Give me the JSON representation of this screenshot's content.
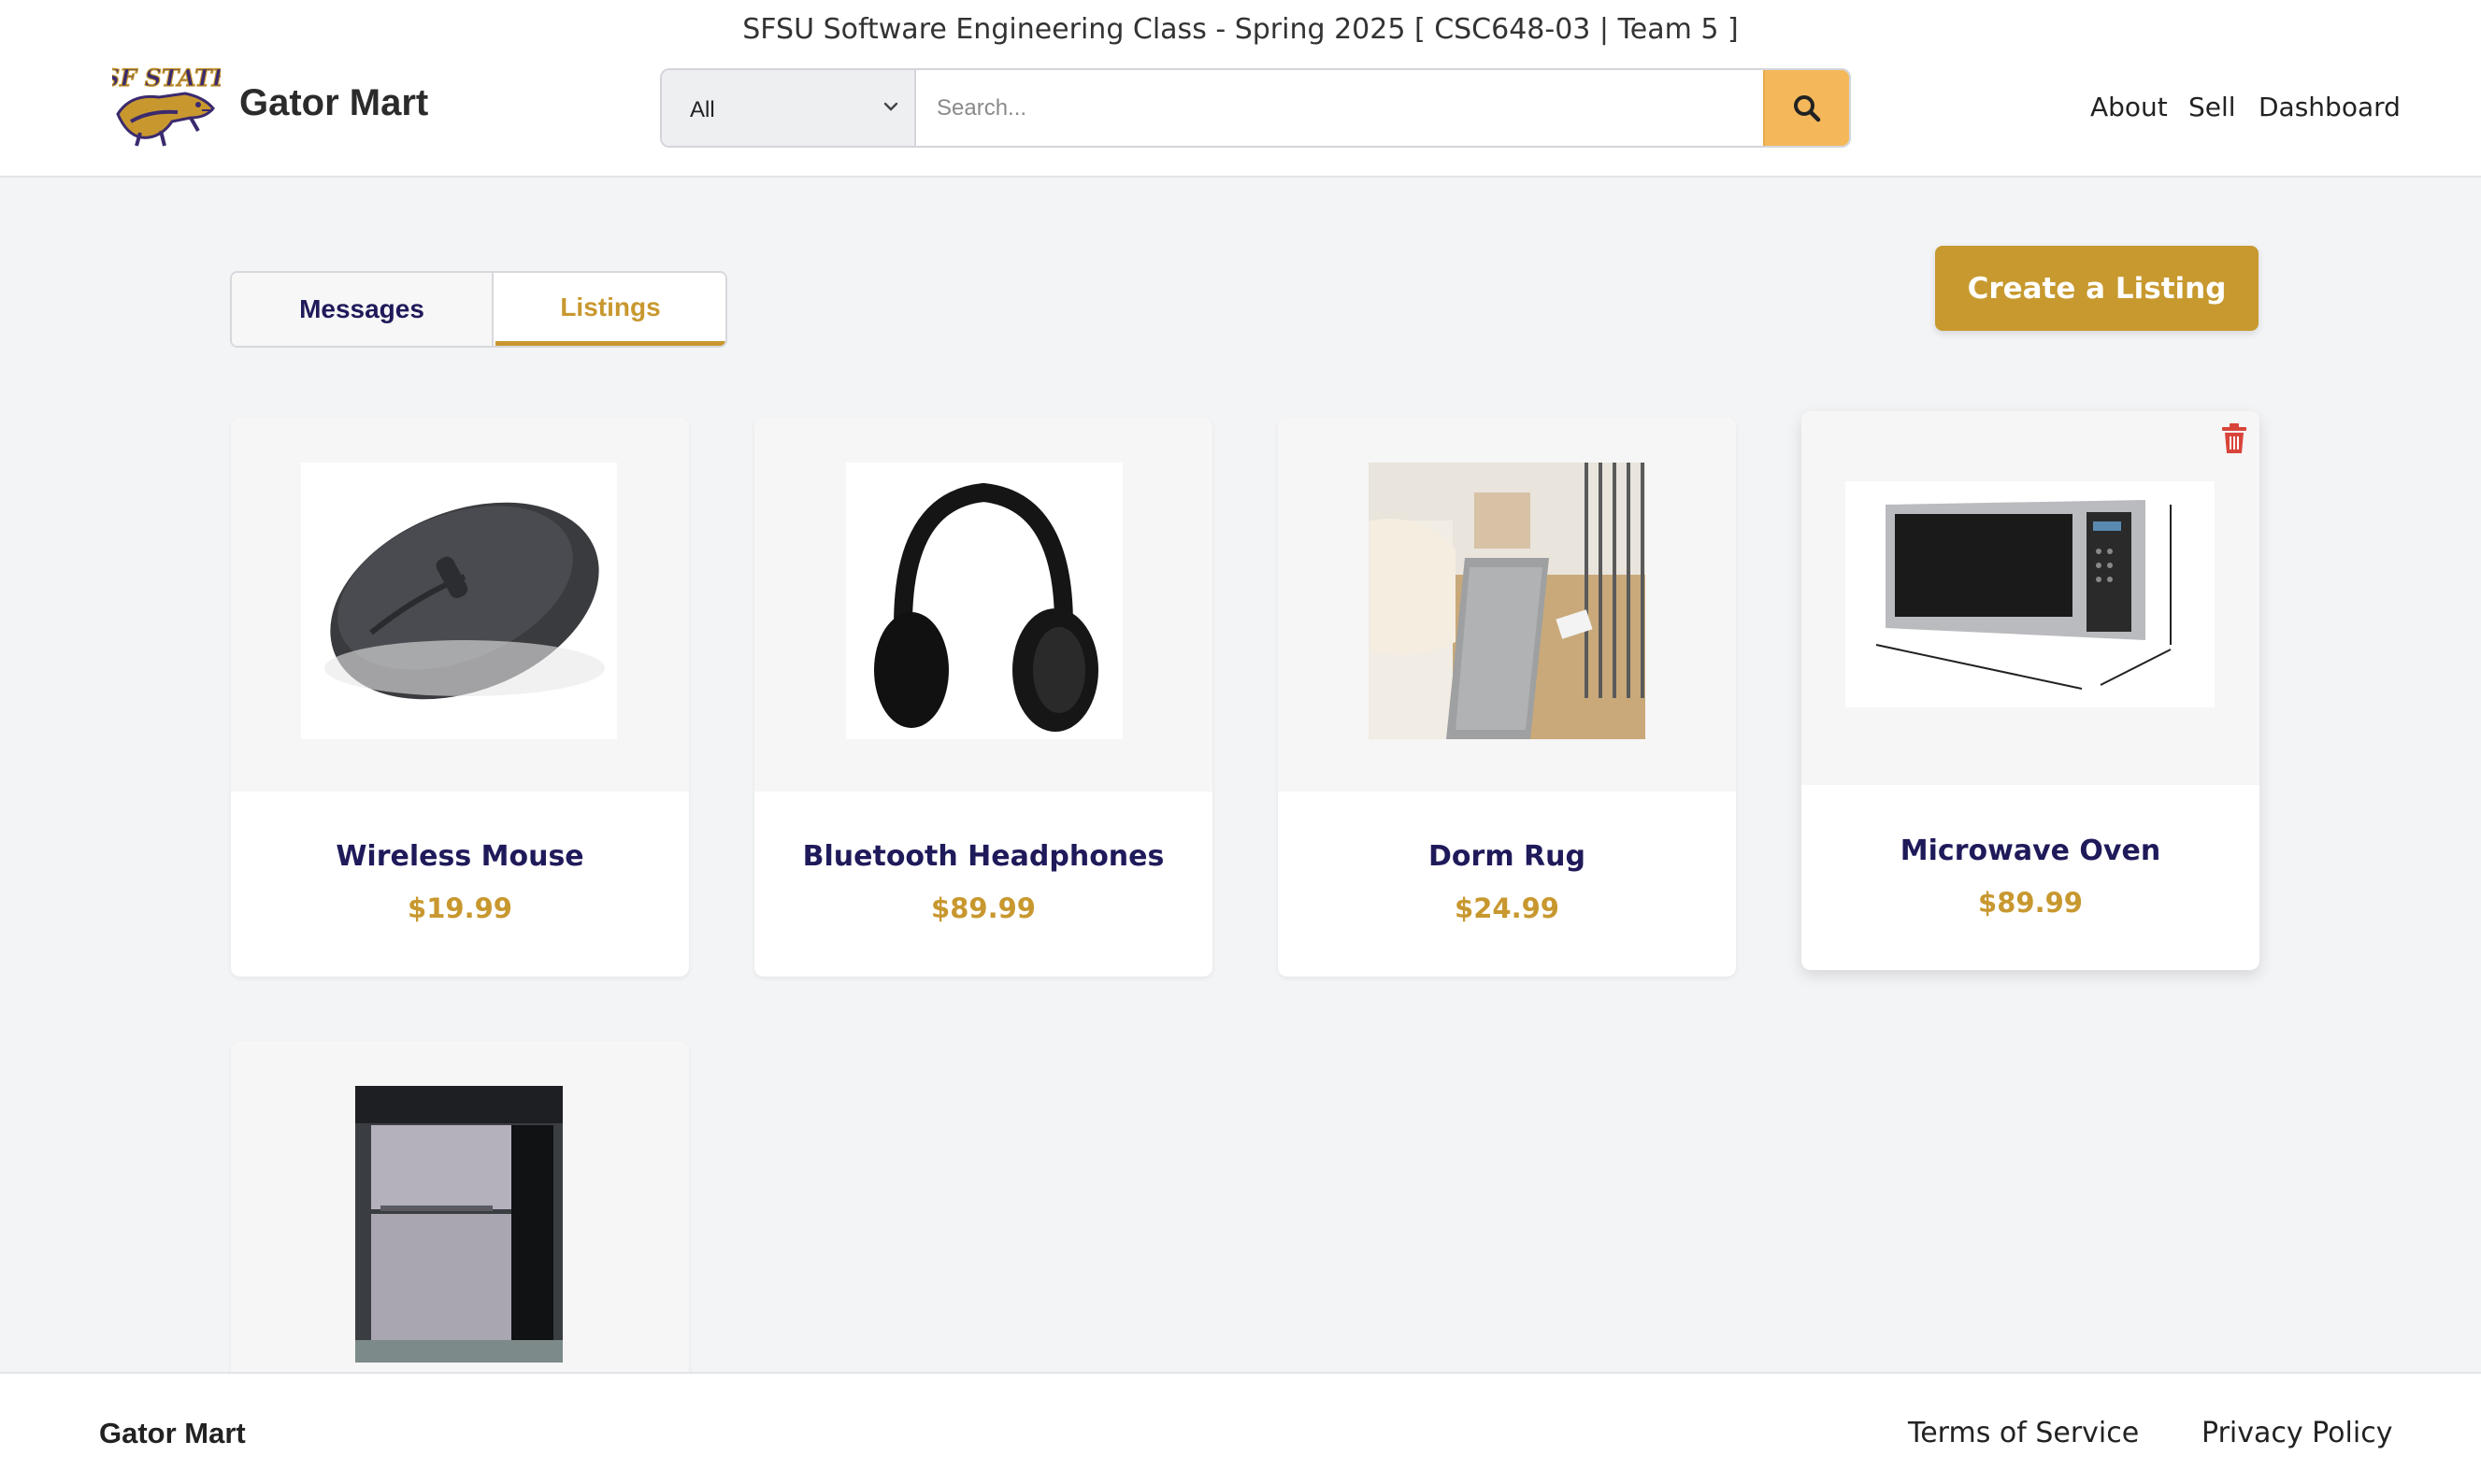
{
  "header": {
    "class_title": "SFSU Software Engineering Class - Spring 2025 [ CSC648-03 | Team 5 ]",
    "brand": "Gator Mart",
    "logo_text": "SF STATE",
    "search": {
      "category": "All",
      "placeholder": "Search..."
    },
    "nav": {
      "about": "About",
      "sell": "Sell",
      "dashboard": "Dashboard"
    }
  },
  "tabs": {
    "messages": "Messages",
    "listings": "Listings",
    "active": "Listings"
  },
  "create_listing_label": "Create a Listing",
  "listings": [
    {
      "name": "Wireless Mouse",
      "price": "$19.99",
      "image": "wireless-mouse"
    },
    {
      "name": "Bluetooth Headphones",
      "price": "$89.99",
      "image": "bluetooth-headphones"
    },
    {
      "name": "Dorm Rug",
      "price": "$24.99",
      "image": "dorm-rug"
    },
    {
      "name": "Microwave Oven",
      "price": "$89.99",
      "image": "microwave-oven",
      "hovered": true
    },
    {
      "name": "",
      "price": "",
      "image": "mini-fridge"
    }
  ],
  "footer": {
    "brand": "Gator Mart",
    "terms": "Terms of Service",
    "privacy": "Privacy Policy"
  },
  "colors": {
    "gold": "#c8982f",
    "navy": "#1f1a5a",
    "search_button": "#f4b85a",
    "delete": "#d9443a"
  }
}
